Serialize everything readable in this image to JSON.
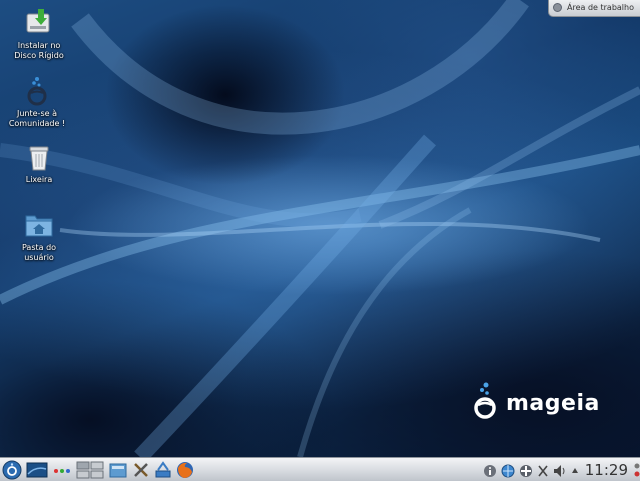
{
  "desktop": {
    "icons": [
      {
        "label": "Instalar no Disco Rígido",
        "icon": "install-disk-icon"
      },
      {
        "label": "Junte-se à Comunidade !",
        "icon": "mageia-community-icon"
      },
      {
        "label": "Lixeira",
        "icon": "trash-icon"
      },
      {
        "label": "Pasta do usuário",
        "icon": "home-folder-icon"
      }
    ],
    "workspace_tab": "Área de trabalho",
    "brand": "mageia"
  },
  "taskbar": {
    "launchers": [
      "mageia-menu-icon",
      "show-desktop-icon",
      "activity-dots-icon",
      "pager-icon",
      "file-manager-icon",
      "system-settings-icon",
      "network-center-icon",
      "firefox-icon"
    ],
    "tray": [
      "info-icon",
      "network-icon",
      "updates-icon",
      "klipper-icon",
      "volume-icon",
      "tray-expand-icon"
    ],
    "clock": "11:29"
  },
  "colors": {
    "wallpaper": "#1a4b80",
    "taskbar": "#d7dbe0",
    "accent": "#3a8fd8"
  }
}
